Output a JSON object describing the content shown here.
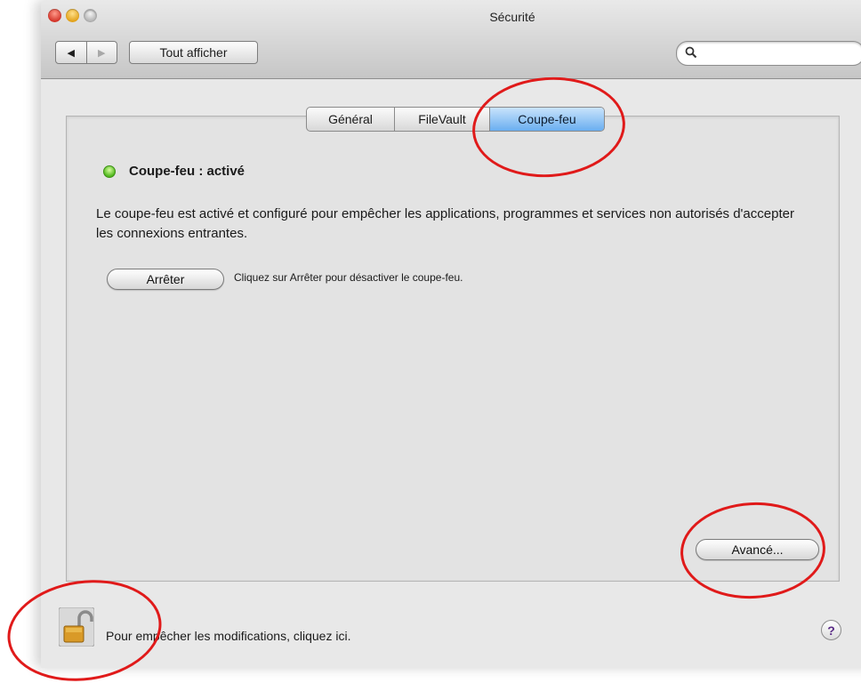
{
  "window": {
    "title": "Sécurité",
    "controls": [
      "close",
      "minimize",
      "zoom"
    ]
  },
  "toolbar": {
    "back_glyph": "◀",
    "forward_glyph": "▶",
    "show_all_label": "Tout afficher",
    "search_value": ""
  },
  "tabs": [
    {
      "label": "Général",
      "selected": false
    },
    {
      "label": "FileVault",
      "selected": false
    },
    {
      "label": "Coupe-feu",
      "selected": true
    }
  ],
  "firewall": {
    "status_label": "Coupe-feu : activé",
    "status_color": "#52b81f",
    "description": "Le coupe-feu est activé et configuré pour empêcher les applications, programmes et services non autorisés d'accepter les connexions entrantes.",
    "stop_button_label": "Arrêter",
    "stop_hint": "Cliquez sur Arrêter pour désactiver le coupe-feu.",
    "advanced_button_label": "Avancé..."
  },
  "footer": {
    "lock_text": "Pour empêcher les modifications, cliquez ici.",
    "help_label": "?"
  },
  "annotations": {
    "color": "#e01a1a"
  }
}
